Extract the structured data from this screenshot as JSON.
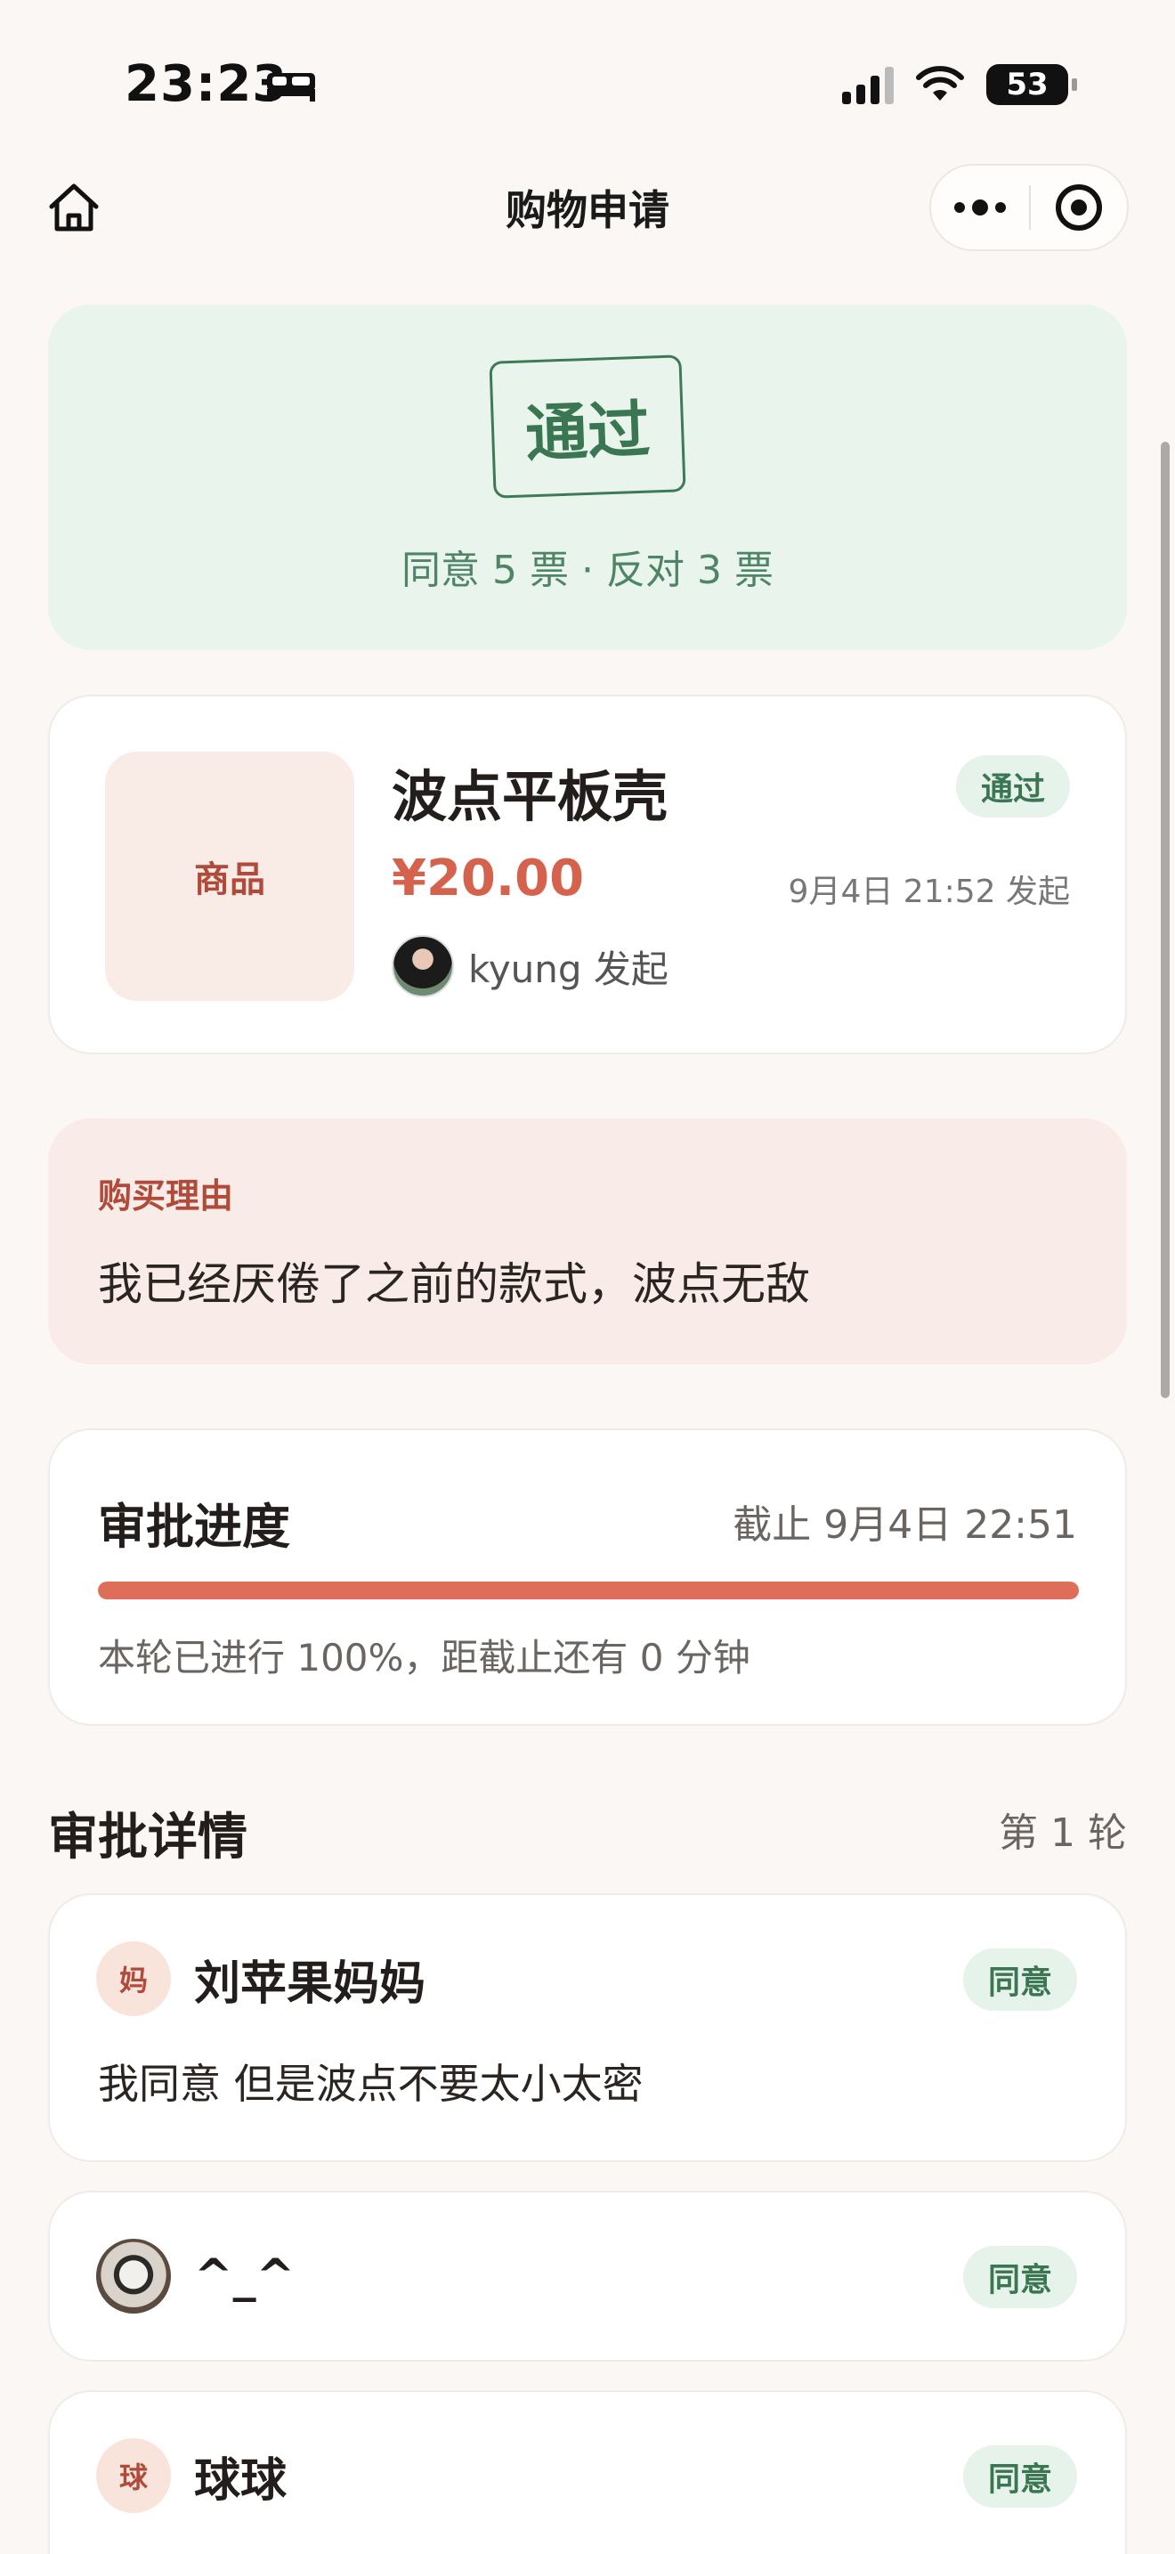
{
  "status_bar": {
    "time": "23:23",
    "battery": "53"
  },
  "nav": {
    "title": "购物申请"
  },
  "result": {
    "status": "通过",
    "votes": "同意 5 票 · 反对 3 票"
  },
  "product": {
    "thumb_label": "商品",
    "name": "波点平板壳",
    "badge": "通过",
    "price": "¥20.00",
    "time": "9月4日 21:52 发起",
    "initiator": "kyung 发起"
  },
  "reason": {
    "label": "购买理由",
    "text": "我已经厌倦了之前的款式，波点无敌"
  },
  "progress": {
    "title": "审批进度",
    "deadline": "截止 9月4日 22:51",
    "percent": 100,
    "note": "本轮已进行 100%，距截止还有 0 分钟"
  },
  "details": {
    "title": "审批详情",
    "round": "第 1 轮",
    "votes": [
      {
        "avatar": "妈",
        "name": "刘苹果妈妈",
        "decision": "同意",
        "comment": "我同意 但是波点不要太小太密"
      },
      {
        "avatar": "",
        "name": "^_^",
        "decision": "同意",
        "comment": ""
      },
      {
        "avatar": "球",
        "name": "球球",
        "decision": "同意",
        "comment": ""
      }
    ]
  },
  "colors": {
    "approve_green": "#3a7652",
    "accent_red": "#d4624d",
    "progress": "#de6d59"
  }
}
